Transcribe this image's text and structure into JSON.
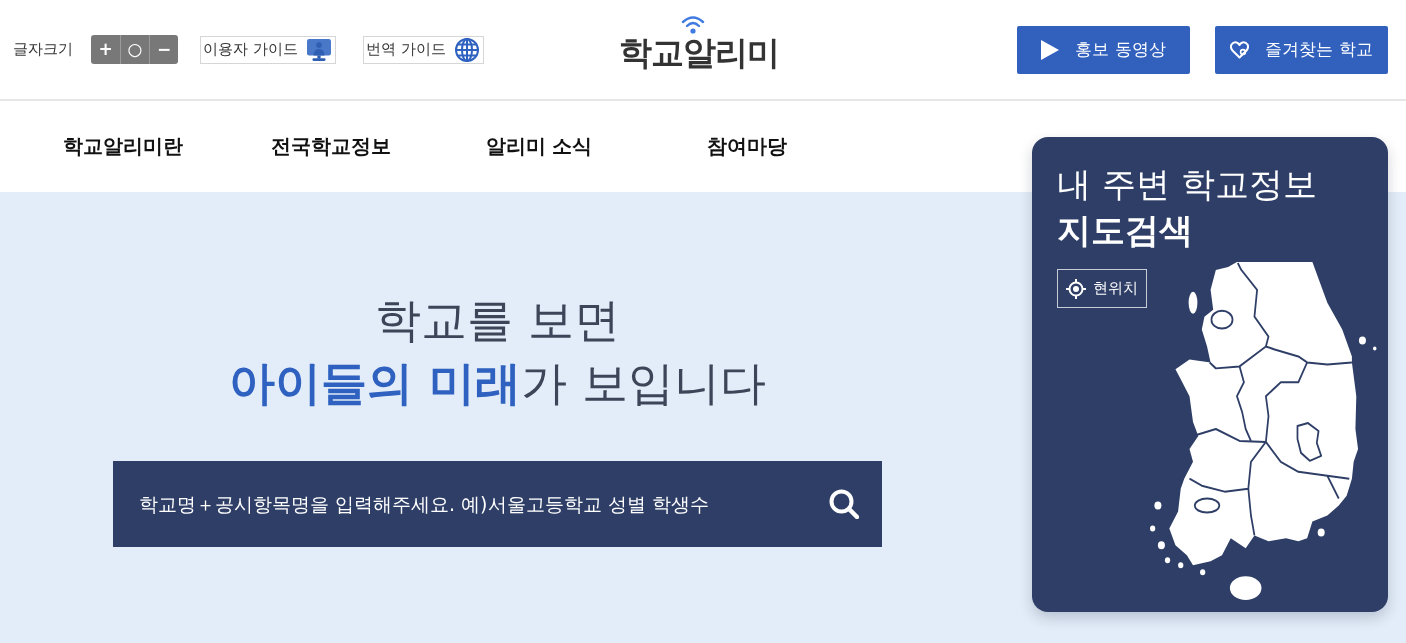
{
  "header": {
    "font_size": {
      "label": "글자크기",
      "buttons": [
        "+",
        "○",
        "−"
      ]
    },
    "guides": [
      {
        "label": "이용자 가이드",
        "kind": "monitor"
      },
      {
        "label": "번역 가이드",
        "kind": "globe"
      }
    ],
    "logo": {
      "text": "학교알리미"
    },
    "actions": [
      {
        "label": "홍보 동영상",
        "kind": "play"
      },
      {
        "label": "즐겨찾는 학교",
        "kind": "heart"
      }
    ]
  },
  "nav": {
    "items": [
      "학교알리미란",
      "전국학교정보",
      "알리미 소식",
      "참여마당"
    ]
  },
  "hero": {
    "title_lines": [
      "학교를 보면",
      "**아이들의 미래**가 보입니다"
    ],
    "search": {
      "placeholder": "학교명＋공시항목명을 입력해주세요. 예)서울고등학교 성별 학생수"
    }
  },
  "map_card": {
    "title": "내 주변 학교정보",
    "subtitle": "지도검색",
    "location_button": "현위치"
  }
}
